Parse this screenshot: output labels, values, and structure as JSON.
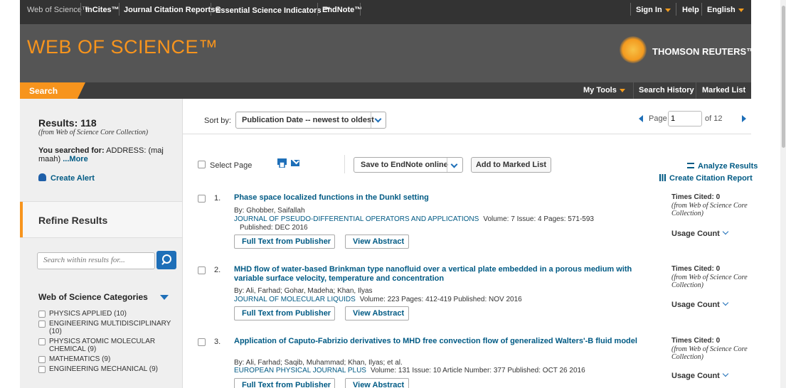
{
  "topbar": {
    "products": [
      "Web of Science™",
      "InCites™",
      "Journal Citation Reports®",
      "Essential Science Indicators ℠",
      "EndNote™"
    ],
    "sign_in": "Sign In",
    "help": "Help",
    "language": "English"
  },
  "header": {
    "brand": "WEB OF SCIENCE™",
    "publisher": "THOMSON REUTERS™"
  },
  "nav": {
    "search": "Search",
    "my_tools": "My Tools",
    "search_history": "Search History",
    "marked_list": "Marked List"
  },
  "sidebar": {
    "results_label": "Results: 118",
    "results_source": "(from Web of Science Core Collection)",
    "searched_prefix": "You searched for:",
    "searched_query": "ADDRESS: (maj maah)",
    "more": "...More",
    "create_alert": "Create Alert",
    "refine_title": "Refine Results",
    "search_placeholder": "Search within results for...",
    "categories_title": "Web of Science Categories",
    "categories": [
      "PHYSICS APPLIED (10)",
      "ENGINEERING MULTIDISCIPLINARY (10)",
      "PHYSICS ATOMIC MOLECULAR CHEMICAL (9)",
      "MATHEMATICS (9)",
      "ENGINEERING MECHANICAL (9)"
    ]
  },
  "sort": {
    "label": "Sort by:",
    "selected": "Publication Date -- newest to oldest"
  },
  "pager": {
    "page_label": "Page",
    "current_page": "1",
    "of_label": "of 12"
  },
  "toolbar": {
    "select_page": "Select Page",
    "save_endnote": "Save to EndNote online",
    "add_marked": "Add to Marked List",
    "analyze": "Analyze Results",
    "citation_report": "Create Citation Report"
  },
  "records": [
    {
      "num": "1.",
      "title": "Phase space localized functions in the Dunkl setting",
      "authors": "By: Ghobber, Saifallah",
      "journal": "JOURNAL OF PSEUDO-DIFFERENTIAL OPERATORS AND APPLICATIONS",
      "details": "Volume: 7   Issue: 4   Pages: 571-593",
      "published": "Published: DEC 2016",
      "full_text": "Full Text from Publisher",
      "view_abstract": "View Abstract",
      "times_cited": "Times Cited: 0",
      "times_cited_source": "(from Web of Science Core Collection)",
      "usage": "Usage Count"
    },
    {
      "num": "2.",
      "title": "MHD flow of water-based Brinkman type nanofluid over a vertical plate embedded in a porous medium with variable surface velocity, temperature and concentration",
      "authors": "By: Ali, Farhad; Gohar, Madeha; Khan, Ilyas",
      "journal": "JOURNAL OF MOLECULAR LIQUIDS",
      "details": "Volume: 223   Pages: 412-419   Published: NOV 2016",
      "published": "",
      "full_text": "Full Text from Publisher",
      "view_abstract": "View Abstract",
      "times_cited": "Times Cited: 0",
      "times_cited_source": "(from Web of Science Core Collection)",
      "usage": "Usage Count"
    },
    {
      "num": "3.",
      "title": "Application of Caputo-Fabrizio derivatives to MHD free convection flow of generalized Walters'-B fluid model",
      "authors": "By: Ali, Farhad; Saqib, Muhammad; Khan, Ilyas; et al.",
      "journal": "EUROPEAN PHYSICAL JOURNAL PLUS",
      "details": "Volume: 131   Issue: 10   Article Number: 377   Published: OCT 26 2016",
      "published": "",
      "full_text": "Full Text from Publisher",
      "view_abstract": "View Abstract",
      "times_cited": "Times Cited: 0",
      "times_cited_source": "(from Web of Science Core Collection)",
      "usage": "Usage Count"
    }
  ],
  "colors": {
    "accent_orange": "#f7941d",
    "link_blue": "#005a84",
    "header_gray": "#555555",
    "topbar_dark": "#333333"
  }
}
